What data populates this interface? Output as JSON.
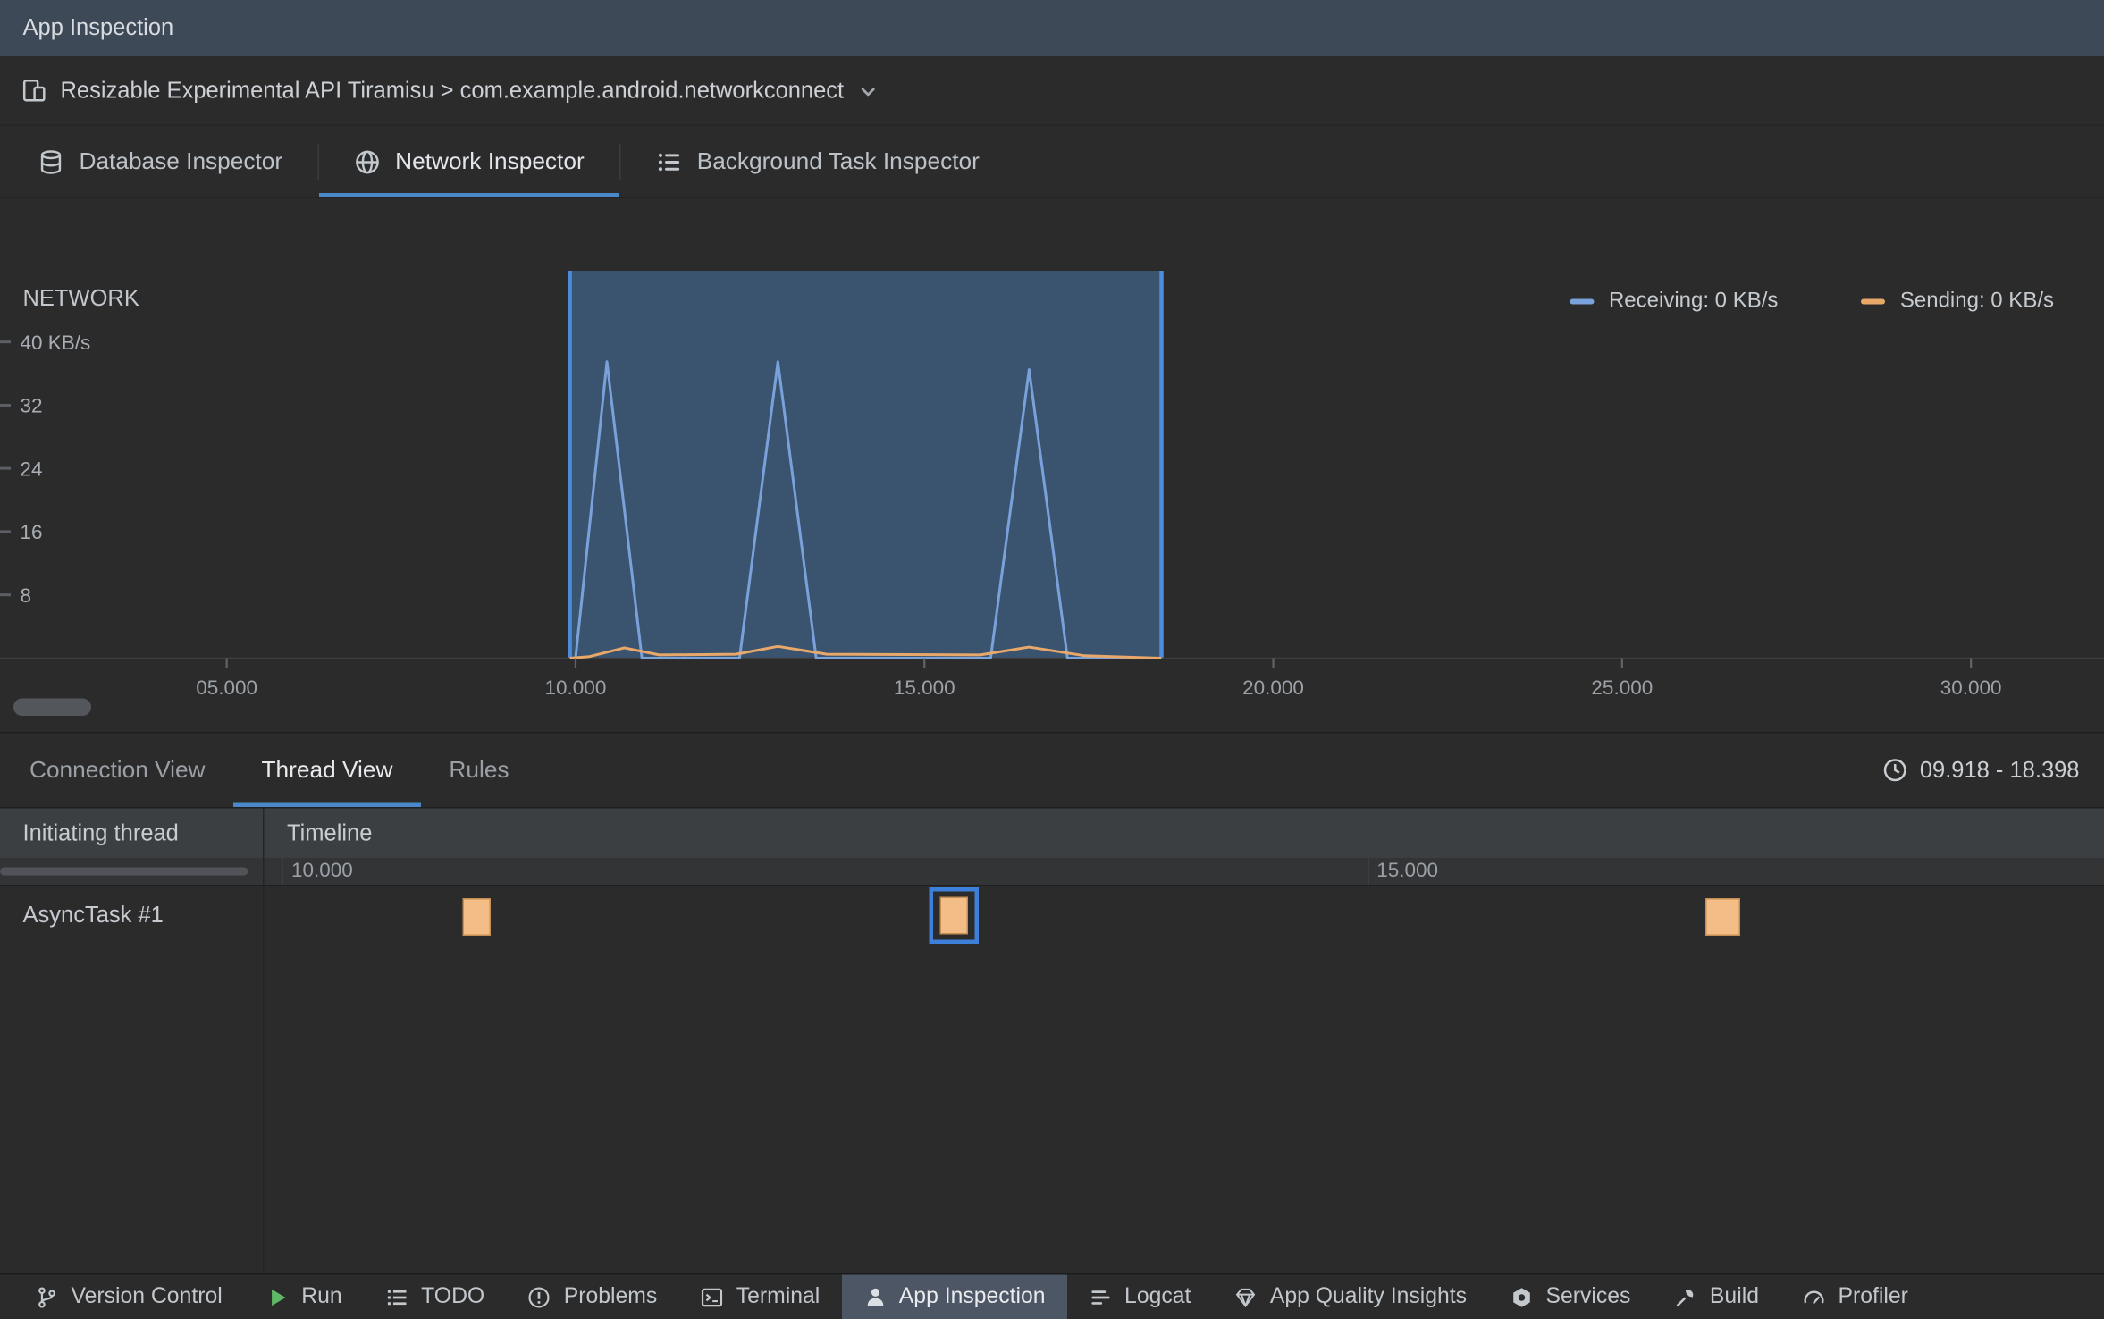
{
  "window": {
    "title": "App Inspection"
  },
  "device_bar": {
    "label": "Resizable Experimental API Tiramisu > com.example.android.networkconnect",
    "icon": "device-icon",
    "chevron": "chevron-down-icon"
  },
  "inspector_tabs": [
    {
      "label": "Database Inspector",
      "icon": "database-icon",
      "selected": false
    },
    {
      "label": "Network Inspector",
      "icon": "globe-icon",
      "selected": true
    },
    {
      "label": "Background Task Inspector",
      "icon": "task-list-icon",
      "selected": false
    }
  ],
  "chart_data": {
    "type": "area",
    "title": "NETWORK",
    "y_axis": {
      "max": 49,
      "ticks": [
        {
          "v": 40,
          "label": "40 KB/s"
        },
        {
          "v": 32,
          "label": "32"
        },
        {
          "v": 24,
          "label": "24"
        },
        {
          "v": 16,
          "label": "16"
        },
        {
          "v": 8,
          "label": "8"
        }
      ]
    },
    "x_axis": {
      "range_s": [
        1.75,
        31.92
      ],
      "ticks": [
        {
          "t": 5,
          "label": "05.000"
        },
        {
          "t": 10,
          "label": "10.000"
        },
        {
          "t": 15,
          "label": "15.000"
        },
        {
          "t": 20,
          "label": "20.000"
        },
        {
          "t": 25,
          "label": "25.000"
        },
        {
          "t": 30,
          "label": "30.000"
        }
      ]
    },
    "selection_s": [
      9.918,
      18.398
    ],
    "selection_fill": "#3A536F",
    "selection_border": "#4E8CDB",
    "series": [
      {
        "name": "Receiving: 0 KB/s",
        "color": "#79A1DA",
        "points": [
          [
            9.918,
            0
          ],
          [
            10.0,
            0
          ],
          [
            10.45,
            37.5
          ],
          [
            10.95,
            0
          ],
          [
            12.35,
            0
          ],
          [
            12.9,
            37.5
          ],
          [
            13.45,
            0
          ],
          [
            15.95,
            0
          ],
          [
            16.5,
            36.5
          ],
          [
            17.05,
            0
          ],
          [
            18.398,
            0
          ]
        ]
      },
      {
        "name": "Sending: 0 KB/s",
        "color": "#E8A869",
        "points": [
          [
            9.918,
            0
          ],
          [
            10.2,
            0.2
          ],
          [
            10.7,
            1.3
          ],
          [
            11.2,
            0.4
          ],
          [
            12.3,
            0.5
          ],
          [
            12.9,
            1.5
          ],
          [
            13.6,
            0.5
          ],
          [
            15.8,
            0.4
          ],
          [
            16.5,
            1.4
          ],
          [
            17.3,
            0.3
          ],
          [
            18.398,
            0
          ]
        ]
      }
    ]
  },
  "view_tabs": [
    {
      "label": "Connection View",
      "selected": false
    },
    {
      "label": "Thread View",
      "selected": true
    },
    {
      "label": "Rules",
      "selected": false
    }
  ],
  "time_range": {
    "icon": "clock-icon",
    "label": "09.918 - 18.398"
  },
  "thread_table": {
    "columns": [
      "Initiating thread",
      "Timeline"
    ],
    "x_range_s": [
      9.918,
      18.398
    ],
    "axis_ticks": [
      {
        "t": 10,
        "label": "10.000"
      },
      {
        "t": 15,
        "label": "15.000"
      }
    ],
    "rows": [
      {
        "thread": "AsyncTask #1",
        "events": [
          {
            "start_s": 10.83,
            "end_s": 10.96,
            "selected": false
          },
          {
            "start_s": 13.03,
            "end_s": 13.16,
            "selected": true
          },
          {
            "start_s": 16.56,
            "end_s": 16.72,
            "selected": false
          }
        ]
      }
    ]
  },
  "status_bar": {
    "items": [
      {
        "label": "Version Control",
        "icon": "git-branch-icon",
        "selected": false
      },
      {
        "label": "Run",
        "icon": "run-icon",
        "selected": false
      },
      {
        "label": "TODO",
        "icon": "todo-icon",
        "selected": false
      },
      {
        "label": "Problems",
        "icon": "problems-icon",
        "selected": false
      },
      {
        "label": "Terminal",
        "icon": "terminal-icon",
        "selected": false
      },
      {
        "label": "App Inspection",
        "icon": "app-inspection-icon",
        "selected": true
      },
      {
        "label": "Logcat",
        "icon": "logcat-icon",
        "selected": false
      },
      {
        "label": "App Quality Insights",
        "icon": "insights-icon",
        "selected": false
      },
      {
        "label": "Services",
        "icon": "services-icon",
        "selected": false
      },
      {
        "label": "Build",
        "icon": "build-icon",
        "selected": false
      },
      {
        "label": "Profiler",
        "icon": "profiler-icon",
        "selected": false
      }
    ]
  },
  "colors": {
    "accent_underline": "#4A88C7",
    "titlebar_bg": "#3D4956",
    "panel_bg": "#2B2B2B",
    "table_header_bg": "#3C3F41",
    "event_block": "#F3BD87",
    "event_selected_border": "#3E7FD9",
    "status_selected_bg": "#4C5664"
  }
}
